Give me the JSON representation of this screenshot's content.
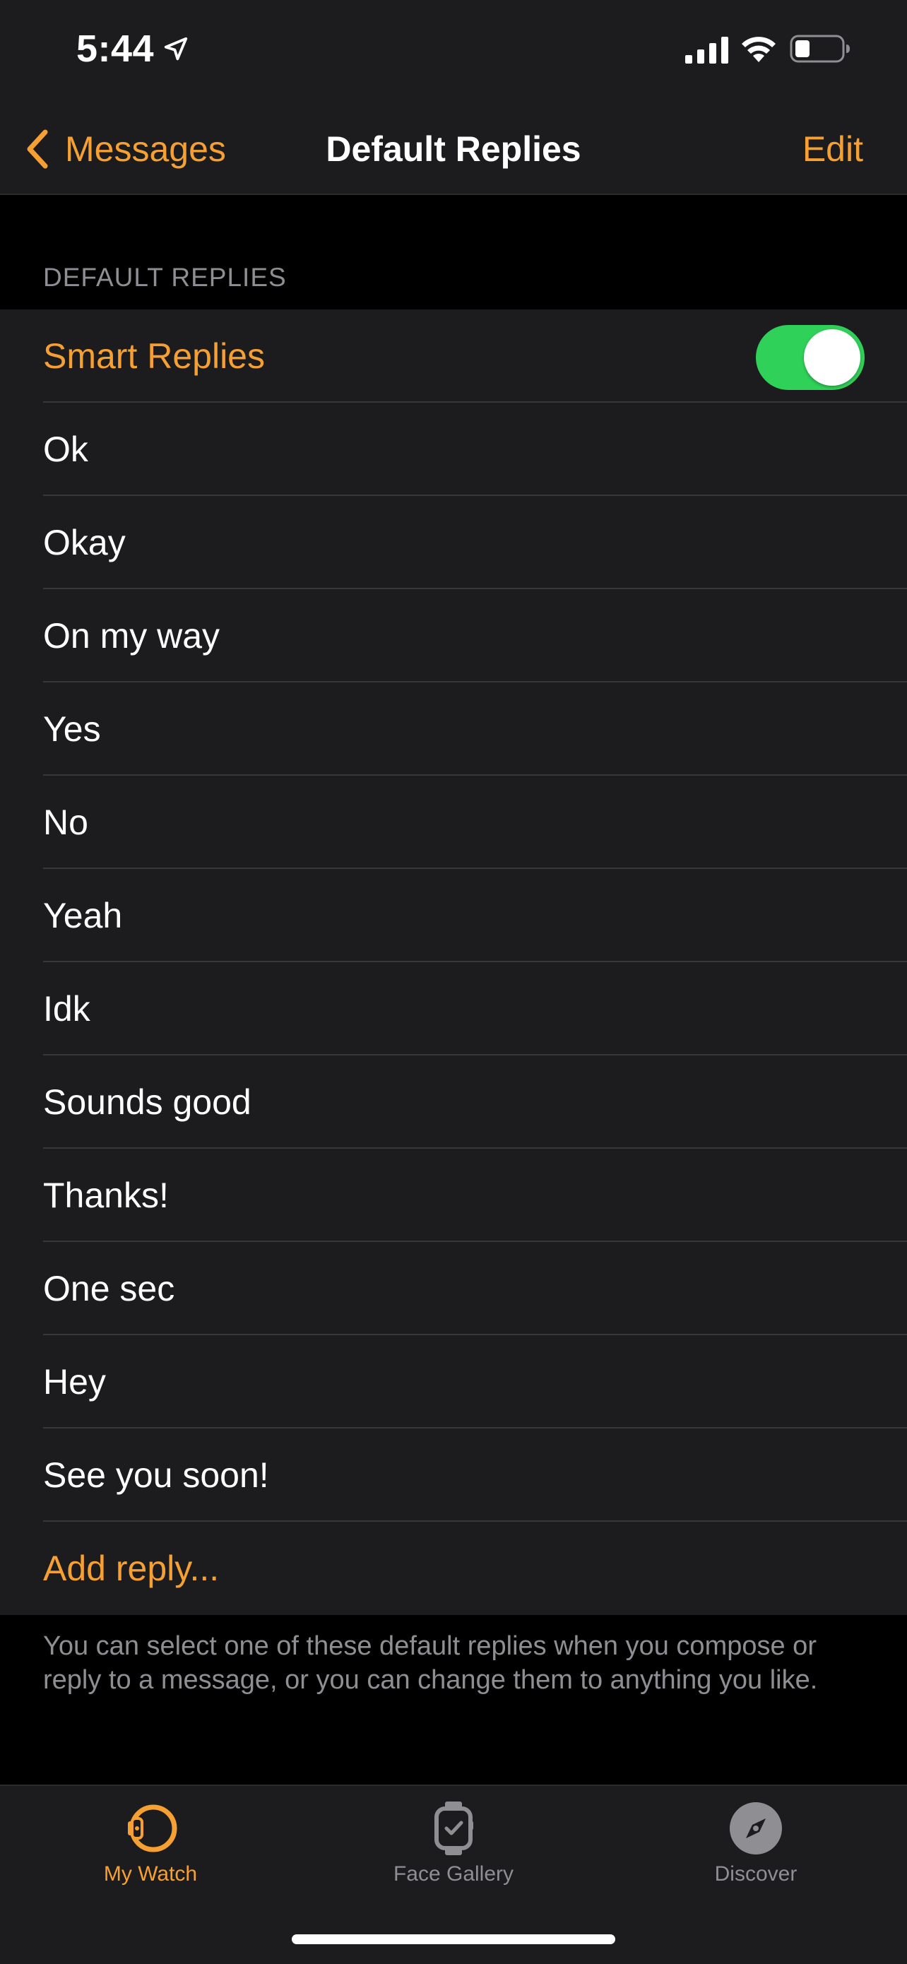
{
  "status_bar": {
    "time": "5:44"
  },
  "nav": {
    "back_label": "Messages",
    "title": "Default Replies",
    "edit_label": "Edit"
  },
  "section": {
    "header": "DEFAULT REPLIES"
  },
  "smart_replies": {
    "label": "Smart Replies",
    "enabled": true
  },
  "replies": [
    "Ok",
    "Okay",
    "On my way",
    "Yes",
    "No",
    "Yeah",
    "Idk",
    "Sounds good",
    "Thanks!",
    "One sec",
    "Hey",
    "See you soon!"
  ],
  "add_reply_label": "Add reply...",
  "footer_note": "You can select one of these default replies when you compose or reply to a message, or you can change them to anything you like.",
  "tabs": [
    {
      "label": "My Watch",
      "icon": "watch-icon",
      "active": true
    },
    {
      "label": "Face Gallery",
      "icon": "face-gallery-icon",
      "active": false
    },
    {
      "label": "Discover",
      "icon": "compass-icon",
      "active": false
    }
  ],
  "colors": {
    "accent": "#f6a033",
    "toggle_on": "#30d158",
    "background": "#000000",
    "cell_background": "#1c1c1e",
    "secondary_text": "#8e8e93"
  }
}
